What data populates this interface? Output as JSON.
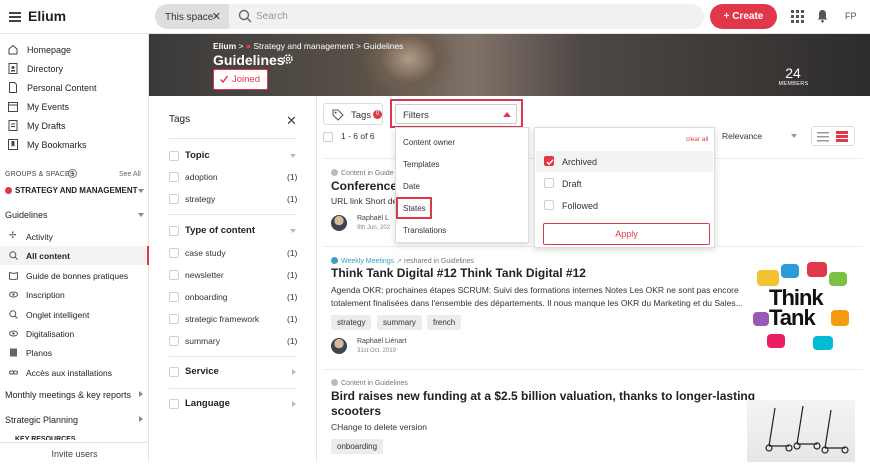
{
  "topbar": {
    "brand": "Elium",
    "scope": "This space",
    "search_placeholder": "Search",
    "create_label": "+ Create",
    "user_initials": "FP"
  },
  "sidebar": {
    "nav": [
      {
        "label": "Homepage",
        "icon": "home-icon"
      },
      {
        "label": "Directory",
        "icon": "directory-icon"
      },
      {
        "label": "Personal Content",
        "icon": "document-icon"
      },
      {
        "label": "My Events",
        "icon": "calendar-icon"
      },
      {
        "label": "My Drafts",
        "icon": "draft-icon"
      },
      {
        "label": "My Bookmarks",
        "icon": "bookmark-icon"
      }
    ],
    "groups_header": "GROUPS & SPACES",
    "see_all": "See All",
    "strategy": "STRATEGY AND MANAGEMENT",
    "guidelines": "Guidelines",
    "sub_items": [
      {
        "label": "Activity",
        "icon": "activity-icon",
        "active": false
      },
      {
        "label": "All content",
        "icon": "search-icon",
        "active": true
      },
      {
        "label": "Guide de bonnes pratiques",
        "icon": "book-icon",
        "active": false
      },
      {
        "label": "Inscription",
        "icon": "eye-icon",
        "active": false
      },
      {
        "label": "Onglet intelligent",
        "icon": "search-icon",
        "active": false
      },
      {
        "label": "Digitalisation",
        "icon": "eye-icon",
        "active": false
      },
      {
        "label": "Planos",
        "icon": "document-icon",
        "active": false
      },
      {
        "label": "Accès aux installations",
        "icon": "link-icon",
        "active": false
      }
    ],
    "groups": [
      "Monthly meetings & key reports",
      "Strategic Planning",
      "KEY RESOURCES"
    ],
    "invite": "Invite users"
  },
  "banner": {
    "breadcrumb_root": "Elium",
    "breadcrumb_mid": "Strategy and management",
    "breadcrumb_leaf": "Guidelines",
    "title": "Guidelines",
    "joined_label": "Joined",
    "members_count": "24",
    "members_label": "MEMBERS"
  },
  "tags_panel": {
    "title": "Tags",
    "topic": "Topic",
    "topic_items": [
      {
        "label": "adoption",
        "count": "(1)"
      },
      {
        "label": "strategy",
        "count": "(1)"
      }
    ],
    "type": "Type of content",
    "type_items": [
      {
        "label": "case study",
        "count": "(1)"
      },
      {
        "label": "newsletter",
        "count": "(1)"
      },
      {
        "label": "onboarding",
        "count": "(1)"
      },
      {
        "label": "strategic framework",
        "count": "(1)"
      },
      {
        "label": "summary",
        "count": "(1)"
      }
    ],
    "service": "Service",
    "language": "Language"
  },
  "toolbar": {
    "tags_label": "Tags",
    "tags_badge": "0",
    "filters_label": "Filters",
    "results": "1 - 6 of 6",
    "sort": "Relevance"
  },
  "filters_menu": [
    "Content owner",
    "Templates",
    "Date",
    "States",
    "Translations"
  ],
  "states_menu": {
    "clear_all": "clear all",
    "options": [
      {
        "label": "Archived",
        "checked": true
      },
      {
        "label": "Draft",
        "checked": false
      },
      {
        "label": "Followed",
        "checked": false
      }
    ],
    "apply": "Apply"
  },
  "cards": [
    {
      "meta": "Content in Guide",
      "title": "Conference v",
      "desc": "URL link Short de",
      "author": "Raphaël L",
      "date": "9th Jun, 202"
    },
    {
      "meta_prefix": "Weekly Meetings",
      "meta": "reshared in Guidelines",
      "title": "Think Tank Digital #12 Think Tank Digital #12",
      "desc1": "Agenda OKR: prochaines étapes SCRUM: Suivi des formations internes Notes Les OKR ne sont pas encore",
      "desc2": "totalement finalisées dans l'ensemble des départements. Il nous manque les OKR du Marketing et du Sales...",
      "tags": [
        "strategy",
        "summary",
        "french"
      ],
      "author": "Raphaël Liénart",
      "date": "31st Oct, 2019",
      "image_text_1": "Think",
      "image_text_2": "Tank"
    },
    {
      "meta": "Content in Guidelines",
      "title1": "Bird raises new funding at a $2.5 billion valuation, thanks to longer-lasting",
      "title2": "scooters",
      "desc": "CHange to delete version",
      "tags": [
        "onboarding"
      ]
    }
  ],
  "colors": {
    "accent": "#e0384a",
    "weekly": "#3aa0c8"
  }
}
